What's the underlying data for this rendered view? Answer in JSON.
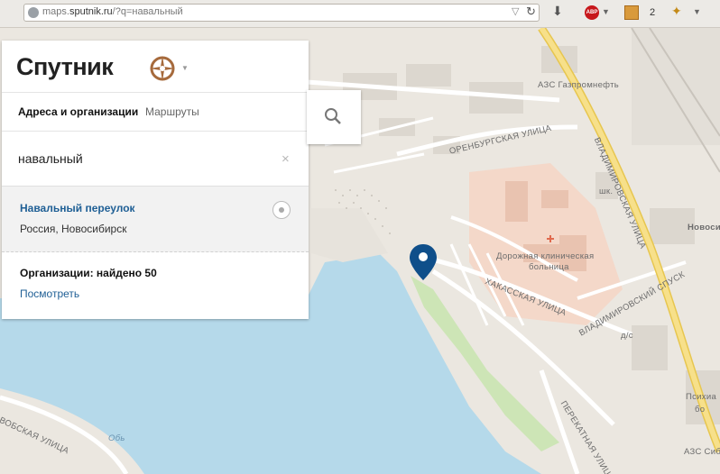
{
  "browser": {
    "url_prefix": "maps.",
    "url_domain": "sputnik.ru",
    "url_path": "/?q=навальный",
    "abp_label": "ABP",
    "extension_count": "2"
  },
  "sidebar": {
    "logo": "Спутник",
    "tabs": [
      {
        "label": "Адреса и организации",
        "active": true
      },
      {
        "label": "Маршруты",
        "active": false
      }
    ],
    "search": {
      "value": "навальный",
      "clear_label": "×"
    },
    "results": [
      {
        "title": "Навальный переулок",
        "subtitle": "Россия, Новосибирск"
      }
    ],
    "orgs": {
      "title": "Организации: найдено 50",
      "link": "Посмотреть"
    }
  },
  "map": {
    "labels": {
      "azs1": "АЗС Газпромнефть",
      "orenburg": "ОРЕНБУРГСКАЯ УЛИЦА",
      "vladimirovskaya": "ВЛАДИМИРОВСКАЯ УЛИЦА",
      "shk": "шк.",
      "novos": "Новосиб",
      "hospital1": "Дорожная клиническая",
      "hospital2": "больница",
      "khakasskaya": "ХАКАССКАЯ УЛИЦА",
      "vladspusk": "ВЛАДИМИРОВСКИЙ СПУСК",
      "ds": "д/с",
      "psych": "Психиа",
      "bo": "бо",
      "perekatnaya": "ПЕРЕКАТНАЯ УЛИЦА",
      "ob": "Обь",
      "vobskaya": "ВОБСКАЯ УЛИЦА",
      "azs2": "АЗС Сиб"
    }
  }
}
